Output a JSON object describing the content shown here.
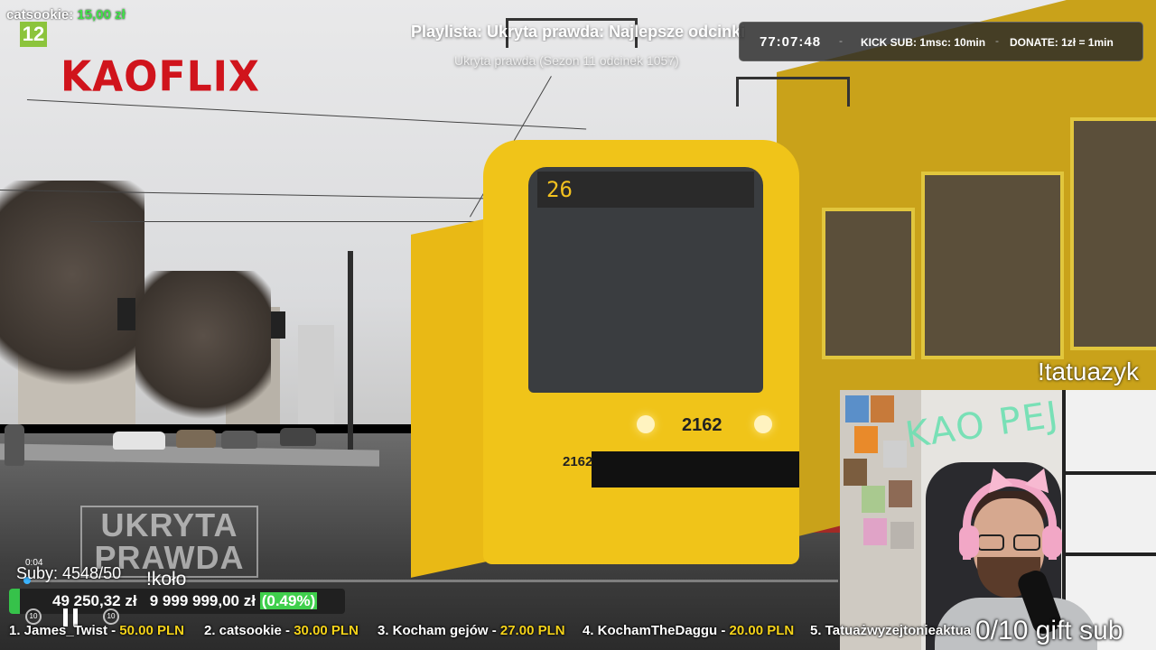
{
  "overlay": {
    "top_user": "catsookie:",
    "top_amount": "15,00 zł",
    "channel_badge": "12",
    "brand": "KAOFLIX",
    "playlist_title": "Playlista: Ukryta prawda: Najlepsze odcinki",
    "episode": "Ukryta prawda (Sezon 11 odcinek 1057)",
    "timer": "77:07:48",
    "kick_sub": "KICK SUB: 1msc: 10min",
    "donate": "DONATE: 1zł = 1min",
    "separator": "-",
    "tatuazyk": "!tatuazyk",
    "show_logo_line1": "UKRYTA",
    "show_logo_line2": "PRAWDA",
    "tram_sign": "26",
    "tram_number": "2162",
    "tram_number_side": "2162"
  },
  "player": {
    "current_time": "0:04",
    "progress": 0.004,
    "subs": "Suby: 4548/50",
    "kolo": "!koło",
    "goal_raised": "49 250,32 zł",
    "goal_target": "9 999 999,00 zł",
    "goal_percent": "(0.49%)",
    "rewind_label": "10",
    "forward_label": "10"
  },
  "ticker": [
    {
      "name": "1. James_Twist -",
      "amount": "50.00 PLN"
    },
    {
      "name": "2. catsookie -",
      "amount": "30.00 PLN"
    },
    {
      "name": "3. Kocham gejów -",
      "amount": "27.00 PLN"
    },
    {
      "name": "4. KochamTheDaggu -",
      "amount": "20.00 PLN"
    },
    {
      "name": "5. Tatuażwyzejtonieaktua",
      "amount": ""
    }
  ],
  "webcam": {
    "wall_text": "KAO PEJ",
    "gift_sub": "0/10 gift sub"
  },
  "colors": {
    "amount_green": "#42e14a",
    "brand_red": "#d0141c",
    "ticker_amount": "#f5d31a",
    "progress_blue": "#3bb4ff",
    "goal_green": "#3fcf4c"
  }
}
